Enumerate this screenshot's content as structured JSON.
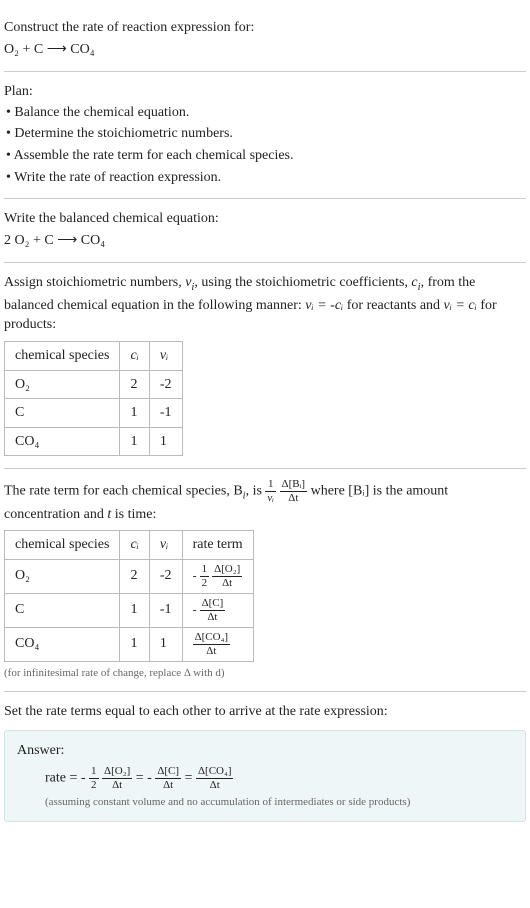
{
  "prompt": {
    "construct_line": "Construct the rate of reaction expression for:",
    "unbalanced_eq": "O₂ + C ⟶ CO₄"
  },
  "plan": {
    "heading": "Plan:",
    "items": [
      "• Balance the chemical equation.",
      "• Determine the stoichiometric numbers.",
      "• Assemble the rate term for each chemical species.",
      "• Write the rate of reaction expression."
    ]
  },
  "balanced": {
    "heading": "Write the balanced chemical equation:",
    "equation": "2 O₂ + C ⟶ CO₄"
  },
  "stoich": {
    "intro_pre": "Assign stoichiometric numbers, ",
    "nu_i": "ν",
    "intro_mid1": ", using the stoichiometric coefficients, ",
    "c_i": "c",
    "intro_mid2": ", from the balanced chemical equation in the following manner: ",
    "rel1": "νᵢ = -cᵢ",
    "rel1_tail": " for reactants and ",
    "rel2": "νᵢ = cᵢ",
    "rel2_tail": " for products:",
    "table": {
      "headers": {
        "species": "chemical species",
        "c": "cᵢ",
        "nu": "νᵢ"
      },
      "rows": [
        {
          "species": "O₂",
          "c": "2",
          "nu": "-2"
        },
        {
          "species": "C",
          "c": "1",
          "nu": "-1"
        },
        {
          "species": "CO₄",
          "c": "1",
          "nu": "1"
        }
      ]
    }
  },
  "rate_term": {
    "intro_pre": "The rate term for each chemical species, B",
    "intro_mid": ", is ",
    "formula_prefix_num": "1",
    "formula_prefix_den": "νᵢ",
    "formula_delta_num": "Δ[Bᵢ]",
    "formula_delta_den": "Δt",
    "intro_post": " where [Bᵢ] is the amount concentration and ",
    "t_is_time": " is time:",
    "t_sym": "t",
    "table": {
      "headers": {
        "species": "chemical species",
        "c": "cᵢ",
        "nu": "νᵢ",
        "rate": "rate term"
      },
      "rows": [
        {
          "species": "O₂",
          "c": "2",
          "nu": "-2",
          "neg": "-",
          "coef_num": "1",
          "coef_den": "2",
          "d_num": "Δ[O₂]",
          "d_den": "Δt"
        },
        {
          "species": "C",
          "c": "1",
          "nu": "-1",
          "neg": "-",
          "coef_num": "",
          "coef_den": "",
          "d_num": "Δ[C]",
          "d_den": "Δt"
        },
        {
          "species": "CO₄",
          "c": "1",
          "nu": "1",
          "neg": "",
          "coef_num": "",
          "coef_den": "",
          "d_num": "Δ[CO₄]",
          "d_den": "Δt"
        }
      ]
    },
    "note": "(for infinitesimal rate of change, replace Δ with d)"
  },
  "final": {
    "heading": "Set the rate terms equal to each other to arrive at the rate expression:",
    "answer_label": "Answer:",
    "rate_eq_prefix": "rate = ",
    "term1_neg": "-",
    "term1_coef_num": "1",
    "term1_coef_den": "2",
    "term1_num": "Δ[O₂]",
    "term1_den": "Δt",
    "eq1": " = ",
    "term2_neg": "-",
    "term2_num": "Δ[C]",
    "term2_den": "Δt",
    "eq2": " = ",
    "term3_num": "Δ[CO₄]",
    "term3_den": "Δt",
    "assumption": "(assuming constant volume and no accumulation of intermediates or side products)"
  }
}
